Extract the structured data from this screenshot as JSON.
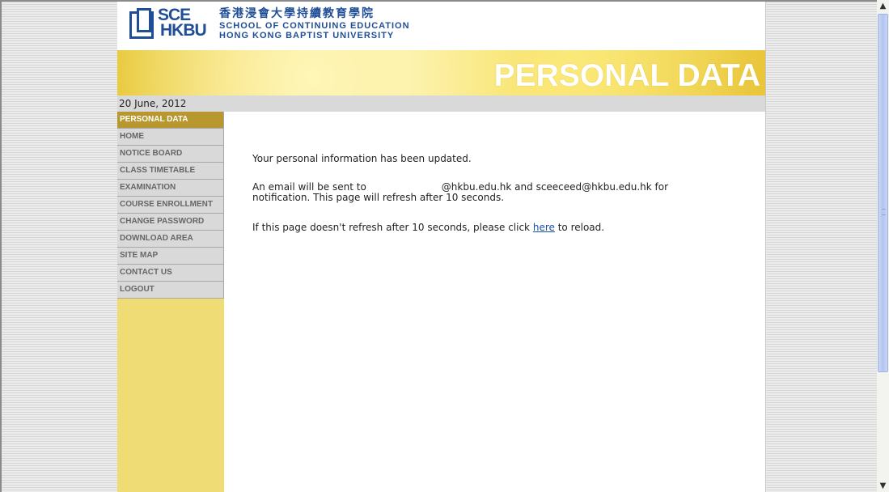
{
  "header": {
    "logo_sce": "SCE",
    "logo_hkbu": "HKBU",
    "school_name_cn": "香港浸會大學持續教育學院",
    "school_name_en_line1": "SCHOOL OF CONTINUING EDUCATION",
    "school_name_en_line2": "HONG KONG BAPTIST UNIVERSITY",
    "banner_title": "PERSONAL DATA"
  },
  "date": "20 June, 2012",
  "nav": {
    "items": [
      {
        "label": "PERSONAL DATA",
        "active": true
      },
      {
        "label": "HOME"
      },
      {
        "label": "NOTICE BOARD"
      },
      {
        "label": "CLASS TIMETABLE"
      },
      {
        "label": "EXAMINATION"
      },
      {
        "label": "COURSE ENROLLMENT"
      },
      {
        "label": "CHANGE PASSWORD"
      },
      {
        "label": "DOWNLOAD AREA"
      },
      {
        "label": "SITE MAP"
      },
      {
        "label": "CONTACT US"
      },
      {
        "label": "LOGOUT"
      }
    ]
  },
  "content": {
    "updated_message": "Your personal information has been updated.",
    "email_prefix": "An email will be sent to",
    "email_suffix": "@hkbu.edu.hk and sceeceed@hkbu.edu.hk for",
    "email_line2": "notification. This page will refresh after 10 seconds.",
    "reload_prefix": "If this page doesn't refresh after 10 seconds, please click",
    "reload_link": "here",
    "reload_suffix": "to reload."
  },
  "colors": {
    "brand_blue": "#1f4e96",
    "banner_yellow": "#f0dc75",
    "nav_active": "#b8982e"
  },
  "icons": {
    "scroll_up": "scroll-up-arrow-icon",
    "scroll_down": "scroll-down-arrow-icon"
  }
}
